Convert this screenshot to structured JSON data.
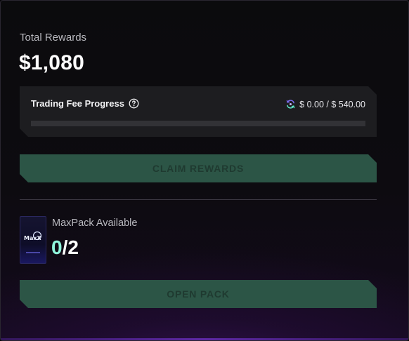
{
  "rewards": {
    "total_label": "Total Rewards",
    "total_value": "$1,080"
  },
  "trading_fee": {
    "title": "Trading Fee Progress",
    "help_icon": "question-circle-icon",
    "sync_icon": "refresh-sync-icon",
    "amount_text": "$ 0.00 / $ 540.00",
    "progress_fraction": 0.0
  },
  "buttons": {
    "claim_label": "CLAIM REWARDS",
    "open_label": "OPEN PACK"
  },
  "maxpack": {
    "label": "MaxPack Available",
    "available": "0",
    "separator_total": "/2",
    "pack_logo_text": "MaxX"
  },
  "colors": {
    "accent_mint": "#8ff5dc",
    "button_bg": "#2c5546",
    "button_text": "#1f3a30",
    "card_bg": "#1d1d20",
    "glow_purple": "#6b2fbf"
  }
}
